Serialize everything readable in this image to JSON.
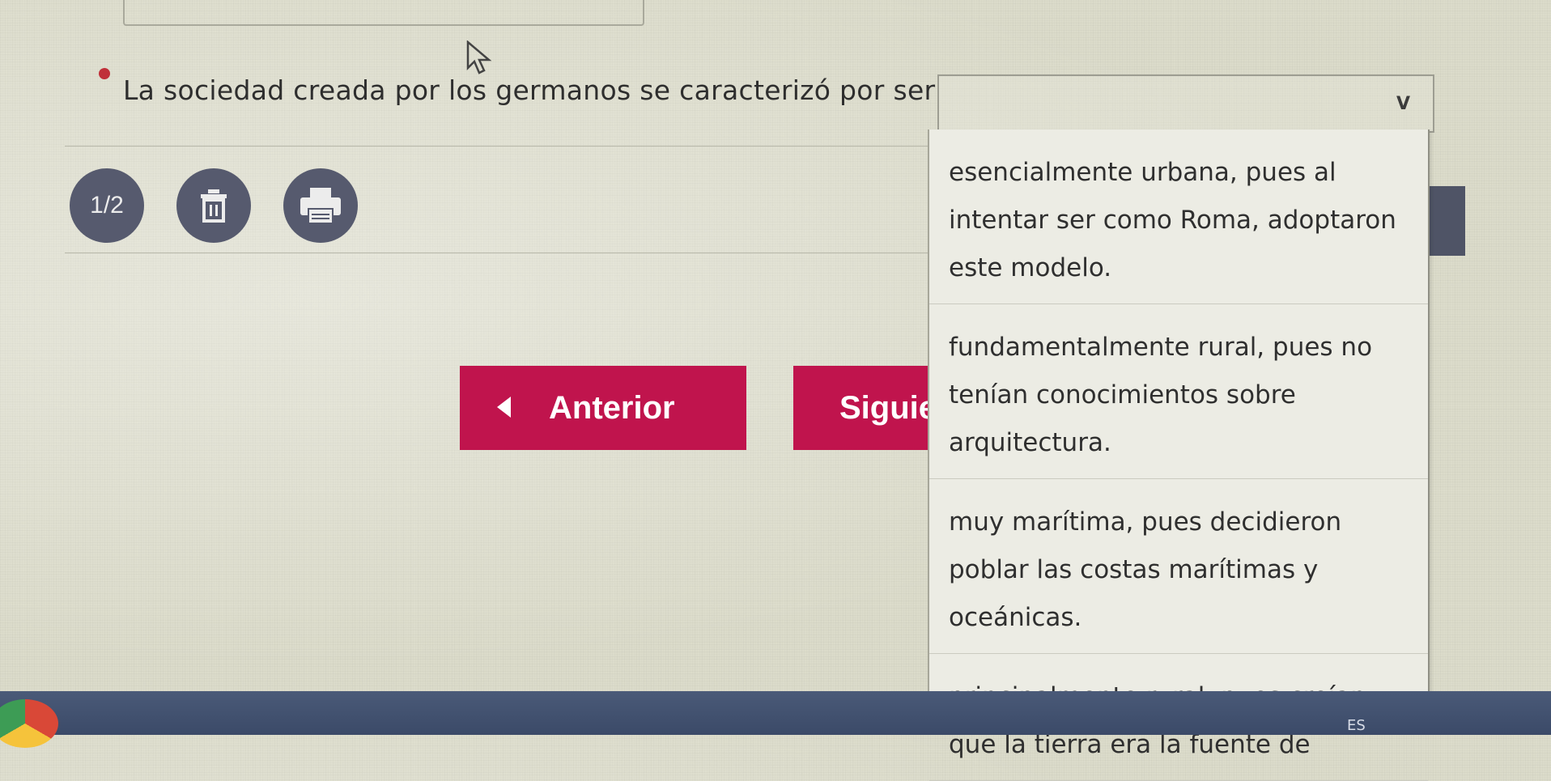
{
  "question": {
    "text": "La sociedad creada por los germanos se caracterizó por ser"
  },
  "dropdown": {
    "selected_value": "",
    "options": [
      "esencialmente urbana, pues al intentar ser como Roma, adoptaron este modelo.",
      "fundamentalmente rural, pues no tenían conocimientos sobre arquitectura.",
      "muy marítima, pues decidieron poblar las costas marítimas y oceánicas.",
      "principalmente rural, pues creían que la tierra era la fuente de"
    ]
  },
  "toolbar": {
    "page_indicator": "1/2"
  },
  "navigation": {
    "prev_label": "Anterior",
    "next_label": "Siguiente"
  },
  "taskbar": {
    "language": "ES"
  },
  "colors": {
    "accent": "#c0144d",
    "circle_button": "#565a6e",
    "bullet": "#c0303a"
  },
  "icons": {
    "delete": "trash-icon",
    "print": "printer-icon",
    "dropdown": "chevron-down-icon",
    "cursor": "mouse-cursor-icon"
  }
}
